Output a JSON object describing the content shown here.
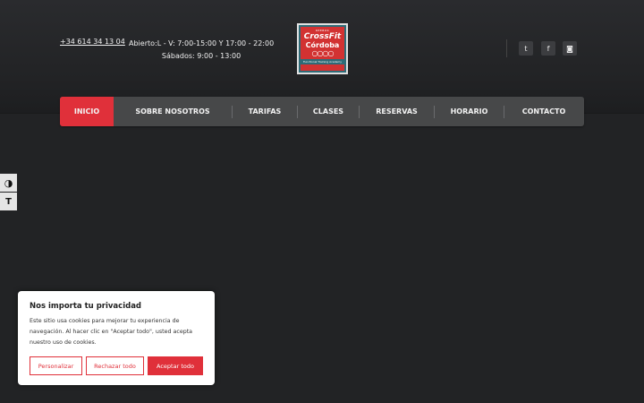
{
  "header": {
    "phone": "+34 614 34 13 04",
    "hours_line1": "Abierto:L - V: 7:00-15:00 Y 17:00 - 22:00",
    "hours_line2": "Sábados: 9:00 - 13:00",
    "logo": {
      "top_text": "REEBOK",
      "brand": "CrossFit",
      "city": "Córdoba",
      "rings": "○○○○",
      "subtitle": "Functional Training Academy"
    },
    "social": [
      {
        "icon": "twitter-icon",
        "glyph": "t"
      },
      {
        "icon": "facebook-icon",
        "glyph": "f"
      },
      {
        "icon": "instagram-icon",
        "glyph": "◙"
      }
    ]
  },
  "nav": {
    "items": [
      "INICIO",
      "SOBRE NOSOTROS",
      "TARIFAS",
      "CLASES",
      "RESERVAS",
      "HORARIO",
      "CONTACTO"
    ],
    "active": "INICIO",
    "accent": "#e0303a"
  },
  "accessibility": {
    "contrast_icon": "◑",
    "font_size_icon": "T"
  },
  "cookie_banner": {
    "title": "Nos importa tu privacidad",
    "text": "Este sitio usa cookies para mejorar tu experiencia de navegación. Al hacer clic en \"Aceptar todo\", usted acepta nuestro uso de cookies.",
    "customize": "Personalizar",
    "reject": "Rechazar todo",
    "accept": "Aceptar todo"
  }
}
